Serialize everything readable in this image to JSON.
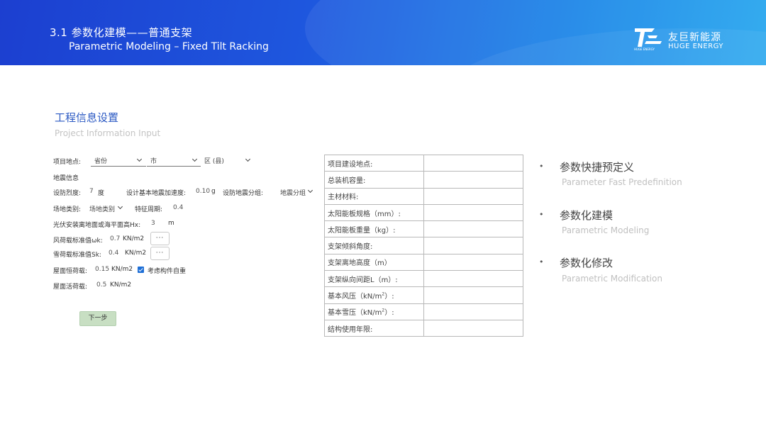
{
  "header": {
    "title_cn": "3.1 参数化建模——普通支架",
    "title_en": "Parametric Modeling – Fixed Tilt Racking",
    "brand_cn": "友巨新能源",
    "brand_en": "HUGE ENERGY",
    "logo_small": "HUGE ENERGY"
  },
  "section": {
    "title_cn": "工程信息设置",
    "title_en": "Project Information  Input"
  },
  "form": {
    "location_label": "项目地点:",
    "province": "省份",
    "city": "市",
    "district": "区 (县)",
    "seismic_heading": "地震信息",
    "intensity_label": "设防烈度:",
    "intensity_value": "7",
    "intensity_unit": "度",
    "accel_label": "设计基本地震加速度:",
    "accel_value": "0.10",
    "accel_unit": "g",
    "group_label": "设防地震分组:",
    "group_select": "地震分组",
    "site_label": "场地类别:",
    "site_select": "场地类别",
    "period_label": "特征周期:",
    "period_value": "0.4",
    "height_label": "光伏安装离地面或海平面高Hx:",
    "height_value": "3",
    "height_unit": "m",
    "wind_label": "风荷载标准值ωk:",
    "wind_value": "0.7",
    "wind_unit": "KN/m2",
    "snow_label": "雪荷载标准值Sk:",
    "snow_value": "0.4",
    "snow_unit": "KN/m2",
    "more": "···",
    "dead_label": "屋面恒荷载:",
    "dead_value": "0.15",
    "dead_unit": "KN/m2",
    "selfweight_label": "考虑构件自重",
    "live_label": "屋面活荷载:",
    "live_value": "0.5",
    "live_unit": "KN/m2",
    "next_button": "下一步"
  },
  "table": {
    "rows": [
      "项目建设地点:",
      "总装机容量:",
      "主材材料:",
      "太阳能板规格（mm）:",
      "太阳能板重量（kg）:",
      "支架倾斜角度:",
      "支架离地高度（m）",
      "支架纵向间距L（m）:",
      "基本风压（kN/m",
      "基本雪压（kN/m",
      "结构使用年限:"
    ],
    "sup": "2",
    "sup_tail": "）:"
  },
  "features": [
    {
      "cn": "参数快捷预定义",
      "en": "Parameter Fast Predefinition"
    },
    {
      "cn": "参数化建模",
      "en": "Parametric Modeling"
    },
    {
      "cn": "参数化修改",
      "en": "Parametric Modification"
    }
  ],
  "bullet": "•",
  "colors": {
    "banner_start": "#1c3fd0",
    "banner_end": "#25a6ee",
    "heading_blue": "#2b59c3",
    "next_button_bg": "#c8dfc3",
    "checkbox_blue": "#1e6fd6"
  }
}
